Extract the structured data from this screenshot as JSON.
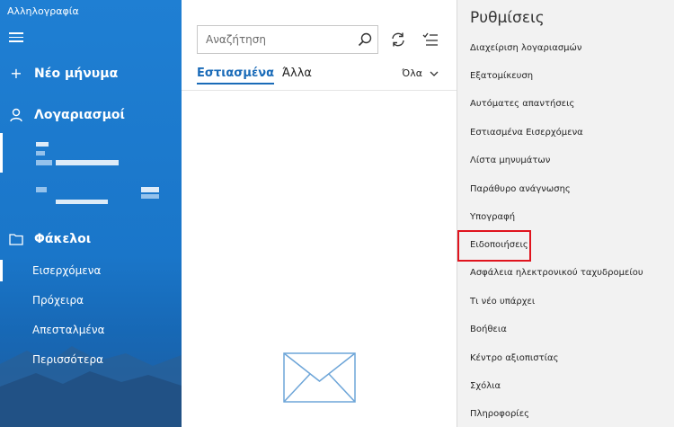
{
  "app": {
    "title": "Αλληλογραφία"
  },
  "sidebar": {
    "new_message": "Νέο μήνυμα",
    "accounts": "Λογαριασμοί",
    "folders": "Φάκελοι",
    "folder_items": [
      "Εισερχόμενα",
      "Πρόχειρα",
      "Απεσταλμένα",
      "Περισσότερα"
    ]
  },
  "search": {
    "placeholder": "Αναζήτηση"
  },
  "tabs": {
    "focused": "Εστιασμένα",
    "other": "Άλλα"
  },
  "filter": {
    "label": "Όλα"
  },
  "settings": {
    "title": "Ρυθμίσεις",
    "items": [
      "Διαχείριση λογαριασμών",
      "Εξατομίκευση",
      "Αυτόματες απαντήσεις",
      "Εστιασμένα Εισερχόμενα",
      "Λίστα μηνυμάτων",
      "Παράθυρο ανάγνωσης",
      "Υπογραφή",
      "Ειδοποιήσεις",
      "Ασφάλεια ηλεκτρονικού ταχυδρομείου",
      "Τι νέο υπάρχει",
      "Βοήθεια",
      "Κέντρο αξιοπιστίας",
      "Σχόλια",
      "Πληροφορίες"
    ],
    "highlighted_index": 7
  },
  "colors": {
    "accent": "#1a6bb8",
    "sidebar": "#1a76c9",
    "highlight": "#e0141e"
  }
}
